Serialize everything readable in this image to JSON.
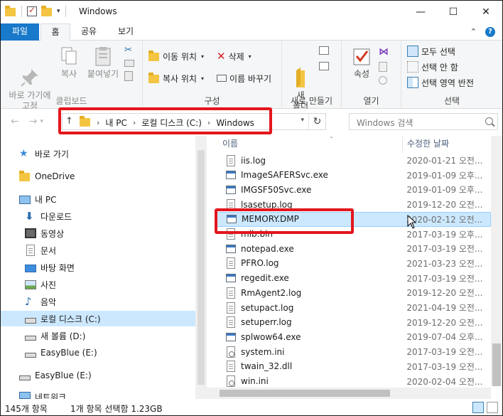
{
  "window": {
    "title": "Windows"
  },
  "ribbon_tabs": {
    "file": "파일",
    "home": "홈",
    "share": "공유",
    "view": "보기"
  },
  "ribbon": {
    "clipboard": {
      "pin": "바로 가기에\n고정",
      "copy": "복사",
      "paste": "붙여넣기",
      "group": "클립보드"
    },
    "organize": {
      "move_to": "이동 위치",
      "copy_to": "복사 위치",
      "delete": "삭제",
      "rename": "이름 바꾸기",
      "group": "구성"
    },
    "new": {
      "new_folder": "새\n폴더",
      "group": "새로 만들기"
    },
    "open": {
      "properties": "속성",
      "group": "열기"
    },
    "select": {
      "select_all": "모두 선택",
      "select_none": "선택 안 함",
      "invert": "선택 영역 반전",
      "group": "선택"
    }
  },
  "address": {
    "crumbs": [
      "내 PC",
      "로컬 디스크 (C:)",
      "Windows"
    ]
  },
  "search": {
    "placeholder": "Windows 검색"
  },
  "nav": [
    {
      "label": "바로 가기",
      "icon": "star-icon"
    },
    {
      "label": "OneDrive",
      "icon": "folder-icon"
    },
    {
      "label": "내 PC",
      "icon": "computer-icon"
    },
    {
      "label": "다운로드",
      "icon": "download-icon"
    },
    {
      "label": "동영상",
      "icon": "video-icon"
    },
    {
      "label": "문서",
      "icon": "document-icon"
    },
    {
      "label": "바탕 화면",
      "icon": "desktop-icon"
    },
    {
      "label": "사진",
      "icon": "picture-icon"
    },
    {
      "label": "음악",
      "icon": "music-icon"
    },
    {
      "label": "로컬 디스크 (C:)",
      "icon": "drive-c-icon"
    },
    {
      "label": "새 볼륨 (D:)",
      "icon": "drive-icon"
    },
    {
      "label": "EasyBlue (E:)",
      "icon": "drive-icon"
    },
    {
      "label": "EasyBlue (E:)",
      "icon": "usb-drive-icon"
    },
    {
      "label": "네트워크",
      "icon": "network-icon"
    }
  ],
  "columns": {
    "name": "이름",
    "date": "수정한 날짜"
  },
  "files": [
    {
      "name": "iis.log",
      "date": "2020-01-21 오전...",
      "type": "doc"
    },
    {
      "name": "ImageSAFERSvc.exe",
      "date": "2019-01-09 오후...",
      "type": "exe"
    },
    {
      "name": "IMGSF50Svc.exe",
      "date": "2019-01-09 오후...",
      "type": "exe"
    },
    {
      "name": "lsasetup.log",
      "date": "2019-12-20 오전...",
      "type": "doc"
    },
    {
      "name": "MEMORY.DMP",
      "date": "2020-02-12 오전...",
      "type": "exe"
    },
    {
      "name": "mib.bin",
      "date": "2017-03-19 오후...",
      "type": "doc"
    },
    {
      "name": "notepad.exe",
      "date": "2017-03-19 오전...",
      "type": "exe"
    },
    {
      "name": "PFRO.log",
      "date": "2021-03-23 오전...",
      "type": "doc"
    },
    {
      "name": "regedit.exe",
      "date": "2017-03-19 오전...",
      "type": "exe"
    },
    {
      "name": "RmAgent2.log",
      "date": "2019-12-20 오전...",
      "type": "doc"
    },
    {
      "name": "setupact.log",
      "date": "2021-04-19 오전...",
      "type": "doc"
    },
    {
      "name": "setuperr.log",
      "date": "2019-12-20 오전...",
      "type": "doc"
    },
    {
      "name": "splwow64.exe",
      "date": "2019-07-04 오후...",
      "type": "exe"
    },
    {
      "name": "system.ini",
      "date": "2017-03-19 오전...",
      "type": "ini"
    },
    {
      "name": "twain_32.dll",
      "date": "2017-03-19 오전...",
      "type": "doc"
    },
    {
      "name": "win.ini",
      "date": "2020-02-04 오전...",
      "type": "ini"
    }
  ],
  "status": {
    "count": "145개 항목",
    "selected": "1개 항목 선택함 1.23GB"
  },
  "colors": {
    "accent": "#1979ca",
    "selection": "#cce8ff",
    "highlight_box": "#e3161c"
  }
}
